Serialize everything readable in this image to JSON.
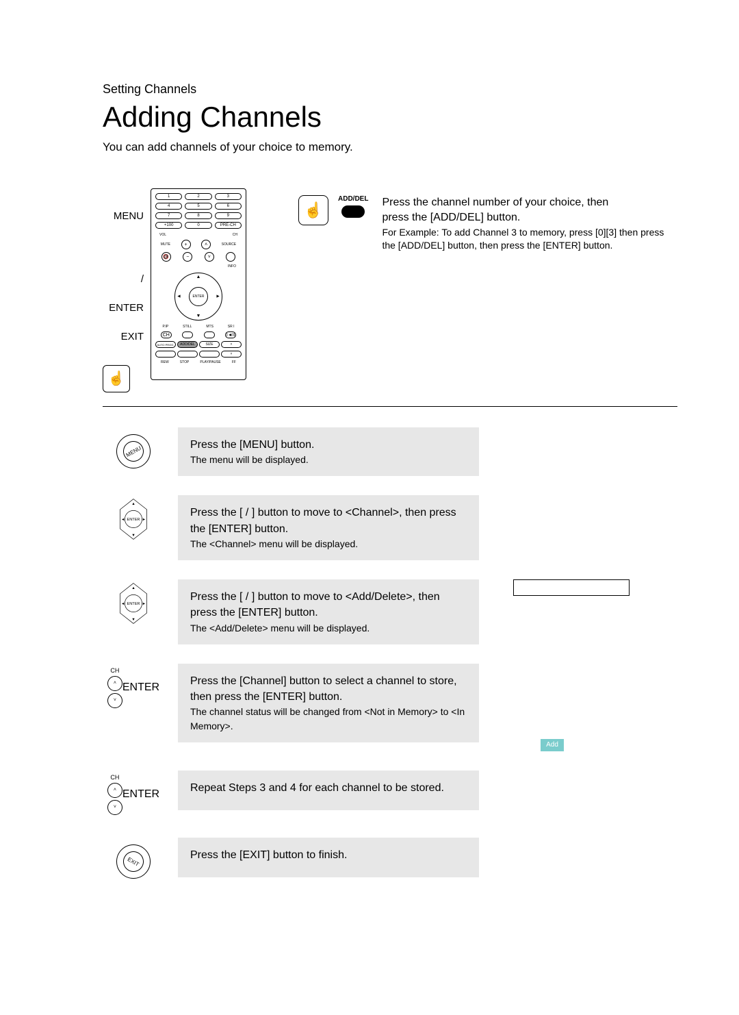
{
  "header": {
    "section": "Setting Channels",
    "title": "Adding Channels",
    "intro": "You can add channels of your choice to memory."
  },
  "top": {
    "labels": {
      "menu": "MENU",
      "slash": "/",
      "enter": "ENTER",
      "exit": "EXIT"
    },
    "adddel_label": "ADD/DEL",
    "desc_line1": "Press the channel number of your choice, then",
    "desc_line2": "press the [ADD/DEL] button.",
    "desc_sub": "For Example: To add Channel 3 to memory, press [0][3] then press the [ADD/DEL] button, then press the [ENTER] button."
  },
  "remote": {
    "numpad": [
      "1",
      "2",
      "3",
      "4",
      "5",
      "6",
      "7",
      "8",
      "9",
      "+100",
      "0",
      "PRE-CH"
    ],
    "labels": {
      "vol": "VOL",
      "ch": "CH",
      "mute": "MUTE",
      "source": "SOURCE",
      "info": "INFO",
      "enter": "ENTER",
      "pip": "P.IP",
      "still": "STILL",
      "mts": "MTS",
      "sri": "SR I",
      "ch_text": "CH",
      "autoprog": "AUTO PROG.",
      "adddel": "ADD/DEL",
      "size": "SIZE",
      "rew": "REW",
      "stop": "STOP",
      "play": "PLAY/PAUSE",
      "ff": "FF"
    }
  },
  "steps": [
    {
      "icon": "menu",
      "main": "Press the [MENU] button.",
      "sub": "The menu will be displayed."
    },
    {
      "icon": "enter",
      "main": "Press the [ /  ] button to move to <Channel>, then press the [ENTER] button.",
      "sub": "The <Channel> menu will be displayed."
    },
    {
      "icon": "enter",
      "main": "Press the [ /  ] button to move to <Add/Delete>, then press the [ENTER] button.",
      "sub": "The <Add/Delete> menu will be displayed.",
      "aside": "box"
    },
    {
      "icon": "ch",
      "main": "Press the [Channel] button to select a channel to store, then press the [ENTER] button.",
      "sub": "The channel status will be changed from <Not in Memory> to <In Memory>.",
      "aside": "add"
    },
    {
      "icon": "ch",
      "main": "Repeat Steps 3 and 4 for each channel to be stored.",
      "sub": ""
    },
    {
      "icon": "exit",
      "main": "Press the [EXIT] button to finish.",
      "sub": ""
    }
  ],
  "icons": {
    "menu_text": "MENU",
    "exit_text": "EXIT",
    "enter_text": "ENTER",
    "ch_text": "CH",
    "add_badge": "Add"
  }
}
